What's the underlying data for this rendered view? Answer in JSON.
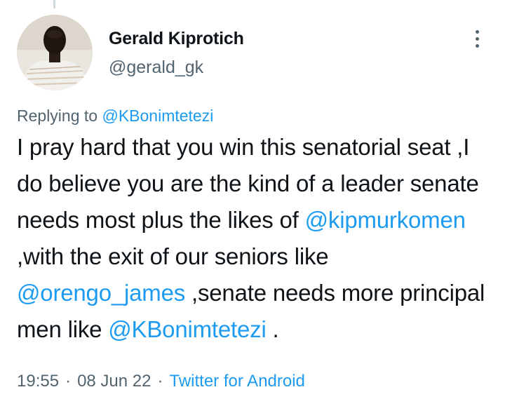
{
  "tweet": {
    "author": {
      "name": "Gerald Kiprotich",
      "handle": "@gerald_gk"
    },
    "replying": {
      "prefix": "Replying to",
      "to": "@KBonimtetezi"
    },
    "body": {
      "t1": "I pray hard that you win this senatorial seat ,I do believe you are the kind of a leader senate needs most plus the likes of",
      "m1": "@kipmurkomen",
      "t2": " ,with the exit of our seniors like",
      "m2": "@orengo_james",
      "t3": " ,senate needs more principal men like",
      "m3": "@KBonimtetezi",
      "t4": " ."
    },
    "meta": {
      "time": "19:55",
      "date": "08 Jun 22",
      "source": "Twitter for Android"
    }
  },
  "icons": {
    "more": "more-vertical-icon",
    "avatar": "avatar-photo"
  },
  "colors": {
    "link": "#1d9bf0",
    "secondary_text": "#536471",
    "primary_text": "#0f1419"
  }
}
